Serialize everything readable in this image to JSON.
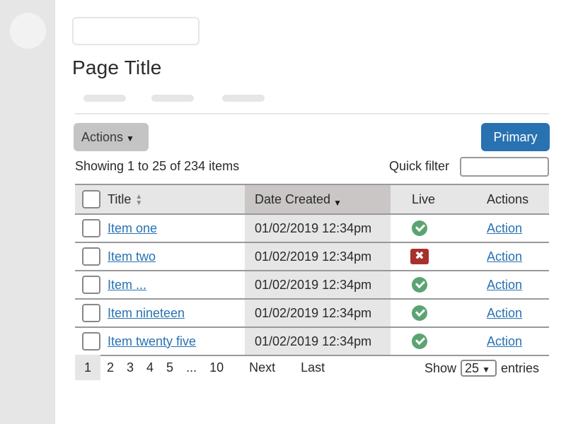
{
  "sidebar": {
    "avatar": "avatar-placeholder"
  },
  "header": {
    "search_value": "",
    "page_title": "Page Title"
  },
  "tabs": [
    {
      "label": ""
    },
    {
      "label": ""
    },
    {
      "label": ""
    }
  ],
  "toolbar": {
    "actions_label": "Actions",
    "actions_caret": "▼",
    "primary_label": "Primary"
  },
  "summary": {
    "showing_text": "Showing 1 to 25 of 234 items",
    "quick_filter_label": "Quick filter",
    "quick_filter_value": ""
  },
  "table": {
    "columns": {
      "title": "Title",
      "date_created": "Date Created",
      "live": "Live",
      "actions": "Actions"
    },
    "sort": {
      "title": "none",
      "date_created": "descending"
    },
    "rows": [
      {
        "title": "Item one",
        "date": "01/02/2019 12:34pm",
        "live": true,
        "live_icon": "check-circle-icon",
        "action": "Action"
      },
      {
        "title": "Item two",
        "date": "01/02/2019 12:34pm",
        "live": false,
        "live_icon": "x-square-icon",
        "action": "Action"
      },
      {
        "title": "Item ...",
        "date": "01/02/2019 12:34pm",
        "live": true,
        "live_icon": "check-circle-icon",
        "action": "Action"
      },
      {
        "title": "Item nineteen",
        "date": "01/02/2019 12:34pm",
        "live": true,
        "live_icon": "check-circle-icon",
        "action": "Action"
      },
      {
        "title": "Item twenty five",
        "date": "01/02/2019 12:34pm",
        "live": true,
        "live_icon": "check-circle-icon",
        "action": "Action"
      }
    ]
  },
  "pagination": {
    "pages": [
      "1",
      "2",
      "3",
      "4",
      "5",
      "...",
      "10"
    ],
    "current": "1",
    "next_label": "Next",
    "last_label": "Last",
    "show_label": "Show",
    "page_size": "25",
    "entries_label": "entries"
  },
  "colors": {
    "primary": "#2872b2",
    "live_ok": "#5ba472",
    "live_off": "#a8312c",
    "link": "#2872b2"
  }
}
